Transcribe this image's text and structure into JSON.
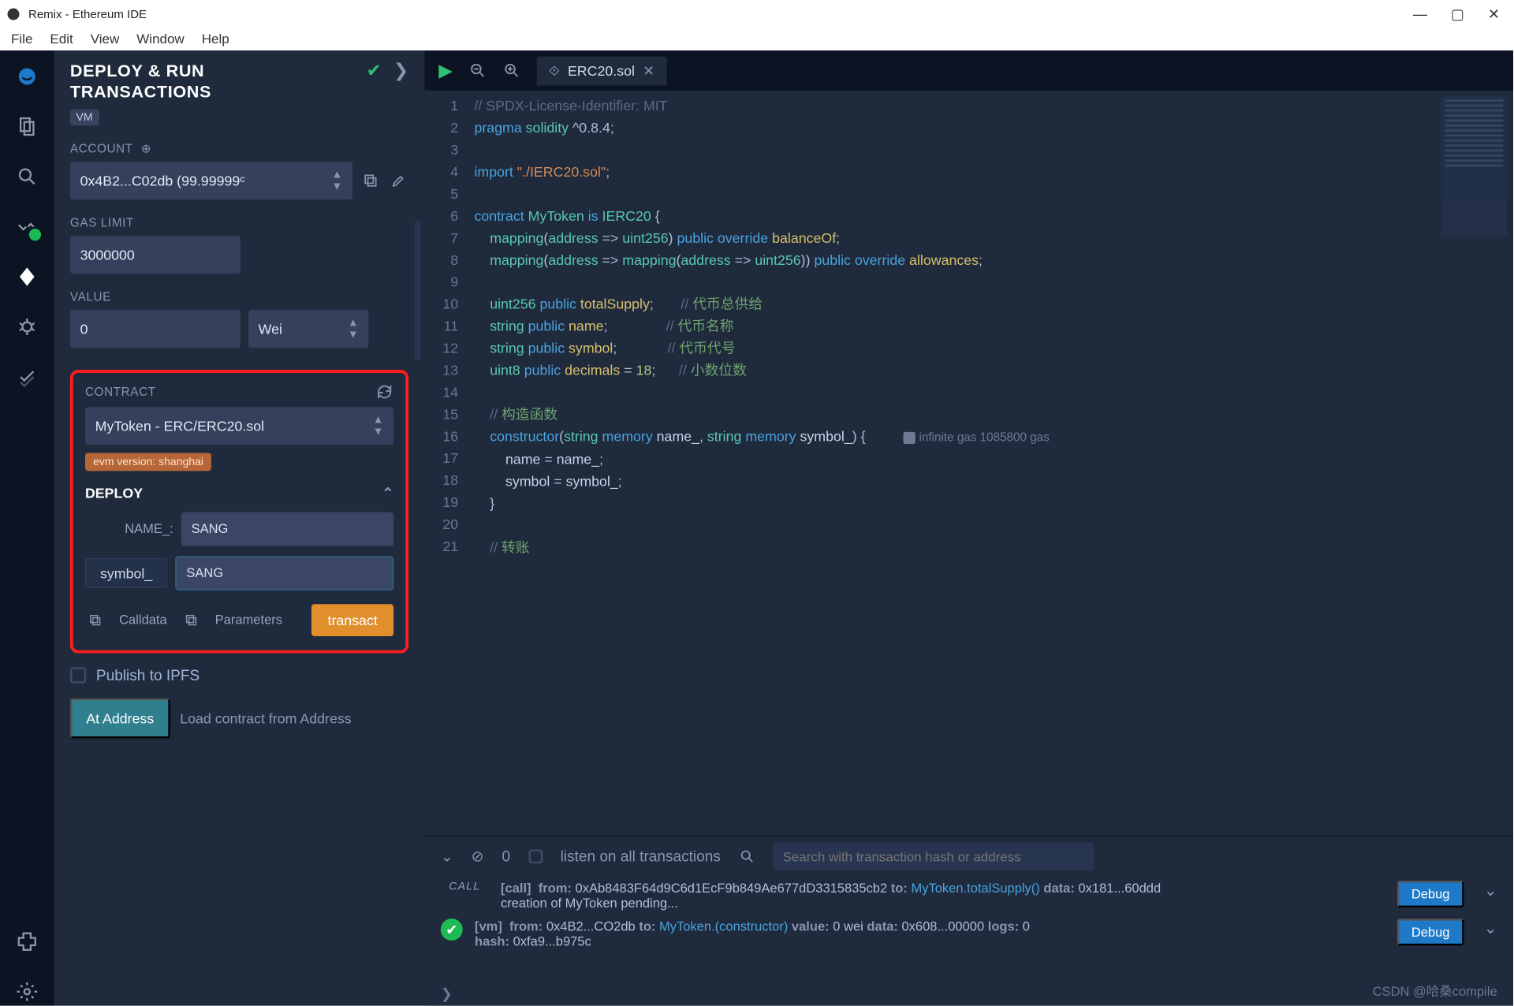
{
  "window": {
    "title": "Remix - Ethereum IDE"
  },
  "menubar": [
    "File",
    "Edit",
    "View",
    "Window",
    "Help"
  ],
  "panel": {
    "title_l1": "DEPLOY & RUN",
    "title_l2": "TRANSACTIONS",
    "vm_tag": "VM",
    "account_label": "ACCOUNT",
    "account_value": "0x4B2...C02db (99.99999ᶜ",
    "gas_limit_label": "GAS LIMIT",
    "gas_limit_value": "3000000",
    "value_label": "VALUE",
    "value_amount": "0",
    "value_unit": "Wei",
    "contract_label": "CONTRACT",
    "contract_selected": "MyToken - ERC/ERC20.sol",
    "evm_version": "evm version: shanghai",
    "deploy_label": "DEPLOY",
    "param_name_label": "NAME_:",
    "param_name_value": "SANG",
    "param_symbol_label": "symbol_",
    "param_symbol_value": "SANG",
    "calldata": "Calldata",
    "parameters": "Parameters",
    "transact": "transact",
    "publish": "Publish to IPFS",
    "at_address": "At Address",
    "load_addr_placeholder": "Load contract from Address"
  },
  "tab": {
    "filename": "ERC20.sol"
  },
  "code": {
    "lines": [
      "// SPDX-License-Identifier: MIT",
      "pragma solidity ^0.8.4;",
      "",
      "import \"./IERC20.sol\";",
      "",
      "contract MyToken is IERC20 {",
      "    mapping(address => uint256) public override balanceOf;",
      "    mapping(address => mapping(address => uint256)) public override allowances;",
      "",
      "    uint256 public totalSupply;      // 代币总供给",
      "    string public name;              // 代币名称",
      "    string public symbol;            // 代币代号",
      "    uint8 public decimals = 18;      // 小数位数",
      "",
      "    // 构造函数",
      "    constructor(string memory name_, string memory symbol_) {",
      "        name = name_;",
      "        symbol = symbol_;",
      "    }",
      "",
      "    // 转账"
    ],
    "gas_note": "infinite gas 1085800 gas"
  },
  "terminal": {
    "count": "0",
    "listen": "listen on all transactions",
    "search_placeholder": "Search with transaction hash or address",
    "debug": "Debug",
    "log1_from": "0xAb8483F64d9C6d1EcF9b849Ae677dD3315835cb2",
    "log1_to": "MyToken.totalSupply()",
    "log1_data": "0x181...60ddd",
    "log1_pending": "creation of MyToken pending...",
    "log2_from": "0x4B2...CO2db",
    "log2_to": "MyToken.(constructor)",
    "log2_value": "0 wei",
    "log2_data": "0x608...00000",
    "log2_logs": "0",
    "log2_hash": "0xfa9...b975c"
  },
  "watermark": "CSDN @哈桑compile"
}
